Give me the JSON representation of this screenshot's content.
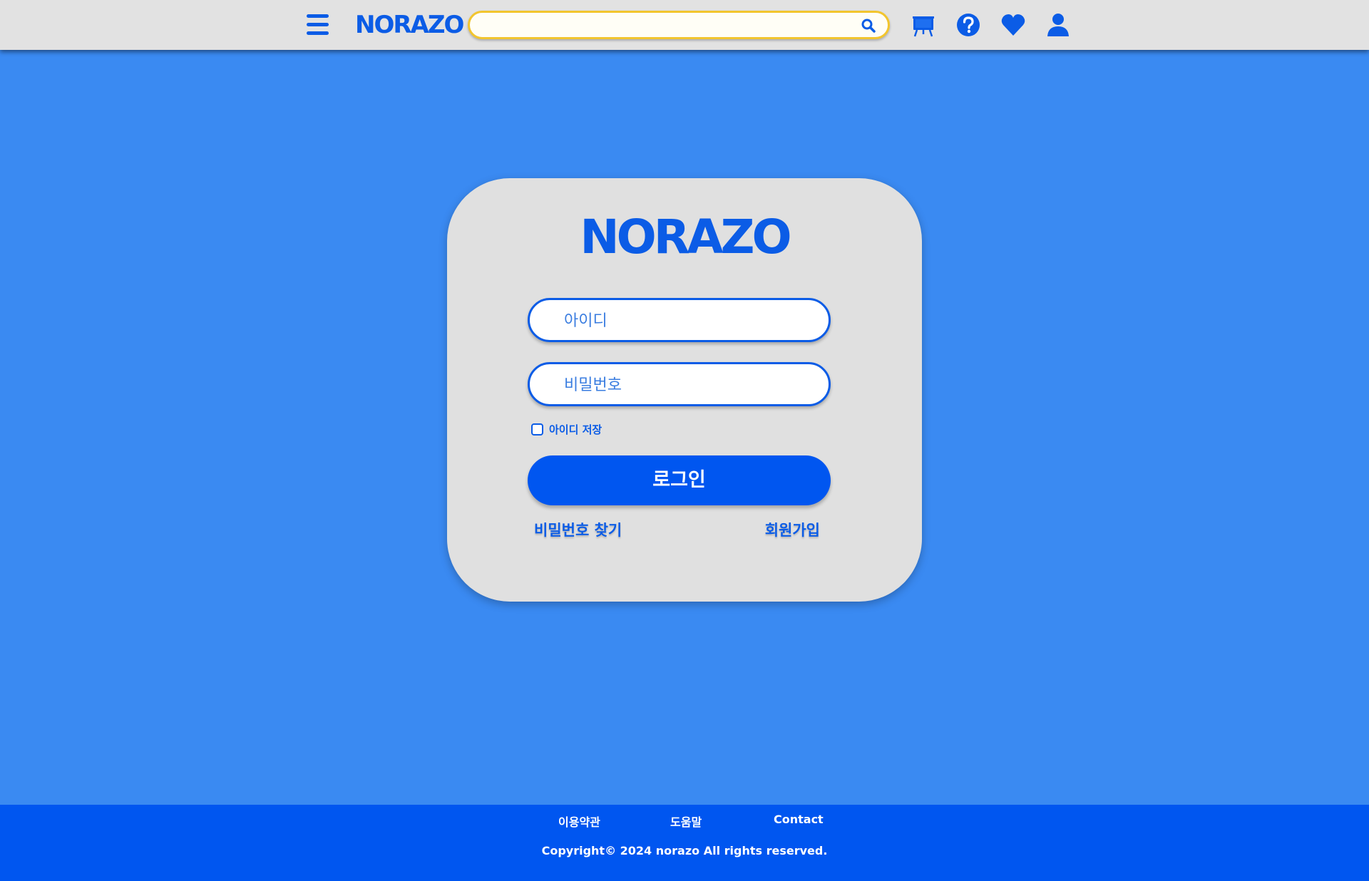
{
  "header": {
    "logo": "NORAZO",
    "search": {
      "value": "",
      "placeholder": ""
    },
    "icons": [
      "menu-icon",
      "search-icon",
      "easel-icon",
      "help-icon",
      "heart-icon",
      "user-icon"
    ]
  },
  "login": {
    "logo": "NORAZO",
    "id_placeholder": "아이디",
    "password_placeholder": "비밀번호",
    "remember_label": "아이디 저장",
    "remember_checked": false,
    "login_button": "로그인",
    "find_password": "비밀번호 찾기",
    "signup": "회원가입"
  },
  "footer": {
    "links": [
      "이용약관",
      "도움말",
      "Contact"
    ],
    "copyright": "Copyright© 2024 norazo All rights reserved."
  },
  "colors": {
    "background": "#3a8af2",
    "brand": "#0b5ce6",
    "button": "#0056f0",
    "search_border": "#f2c52e",
    "card": "#e0e0e0"
  }
}
